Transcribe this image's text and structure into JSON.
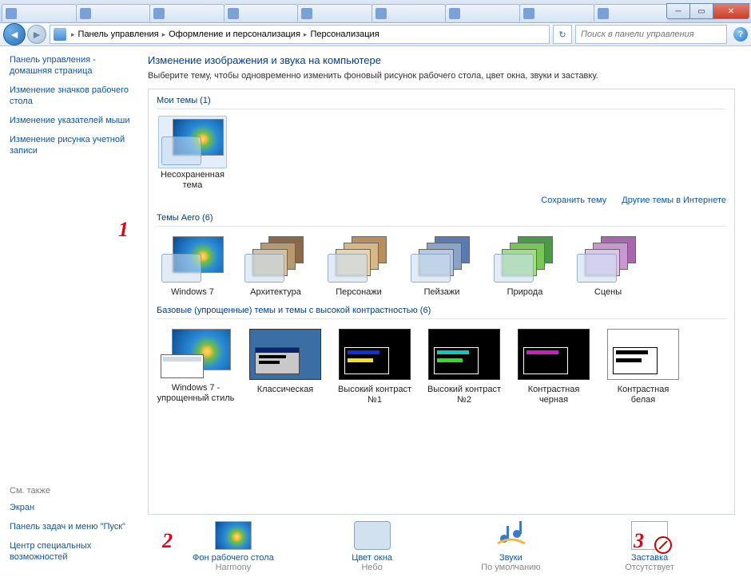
{
  "window": {
    "tabs_count": 9
  },
  "toolbar": {
    "breadcrumbs": [
      "Панель управления",
      "Оформление и персонализация",
      "Персонализация"
    ],
    "search_placeholder": "Поиск в панели управления"
  },
  "sidebar": {
    "links": [
      "Панель управления - домашняя страница",
      "Изменение значков рабочего стола",
      "Изменение указателей мыши",
      "Изменение рисунка учетной записи"
    ],
    "see_also_label": "См. также",
    "see_also": [
      "Экран",
      "Панель задач и меню \"Пуск\"",
      "Центр специальных возможностей"
    ]
  },
  "main": {
    "title": "Изменение изображения и звука на компьютере",
    "description": "Выберите тему, чтобы одновременно изменить фоновый рисунок рабочего стола, цвет окна, звуки и заставку.",
    "my_themes_label": "Мои темы (1)",
    "my_themes": [
      {
        "name": "Несохраненная тема",
        "selected": true
      }
    ],
    "save_theme_label": "Сохранить тему",
    "more_themes_label": "Другие темы в Интернете",
    "aero_label": "Темы Aero (6)",
    "aero_themes": [
      {
        "name": "Windows 7",
        "kind": "win7"
      },
      {
        "name": "Архитектура",
        "kind": "stack",
        "colors": [
          "#8a6a4a",
          "#b89a70",
          "#d6c2a0"
        ]
      },
      {
        "name": "Персонажи",
        "kind": "stack",
        "colors": [
          "#b89060",
          "#d8b888",
          "#e8d4b0"
        ]
      },
      {
        "name": "Пейзажи",
        "kind": "stack",
        "colors": [
          "#5a7ab0",
          "#8aa4c8",
          "#b8c8e0"
        ]
      },
      {
        "name": "Природа",
        "kind": "stack",
        "colors": [
          "#4a9a4a",
          "#78c858",
          "#a0e080"
        ]
      },
      {
        "name": "Сцены",
        "kind": "stack",
        "colors": [
          "#a868b0",
          "#c898d0",
          "#e0c4e8"
        ]
      }
    ],
    "basic_label": "Базовые (упрощенные) темы и темы с высокой контрастностью (6)",
    "basic_themes": [
      {
        "name": "Windows 7 - упрощенный стиль",
        "kind": "basic-win7"
      },
      {
        "name": "Классическая",
        "kind": "classic"
      },
      {
        "name": "Высокий контраст №1",
        "kind": "hc",
        "bar1": "#1030d8",
        "bar2": "#f0e020"
      },
      {
        "name": "Высокий контраст №2",
        "kind": "hc",
        "bar1": "#10c8b8",
        "bar2": "#30e020"
      },
      {
        "name": "Контрастная черная",
        "kind": "hc",
        "bar1": "#c820c0",
        "bar2": "#000"
      },
      {
        "name": "Контрастная белая",
        "kind": "hc-white",
        "bar1": "#000",
        "bar2": "#000"
      }
    ]
  },
  "bottom": {
    "items": [
      {
        "label": "Фон рабочего стола",
        "sub": "Harmony",
        "icon": "bg"
      },
      {
        "label": "Цвет окна",
        "sub": "Небо",
        "icon": "color"
      },
      {
        "label": "Звуки",
        "sub": "По умолчанию",
        "icon": "sound"
      },
      {
        "label": "Заставка",
        "sub": "Отсутствует",
        "icon": "saver"
      }
    ]
  },
  "annotations": {
    "a1": "1",
    "a2": "2",
    "a3": "3"
  }
}
